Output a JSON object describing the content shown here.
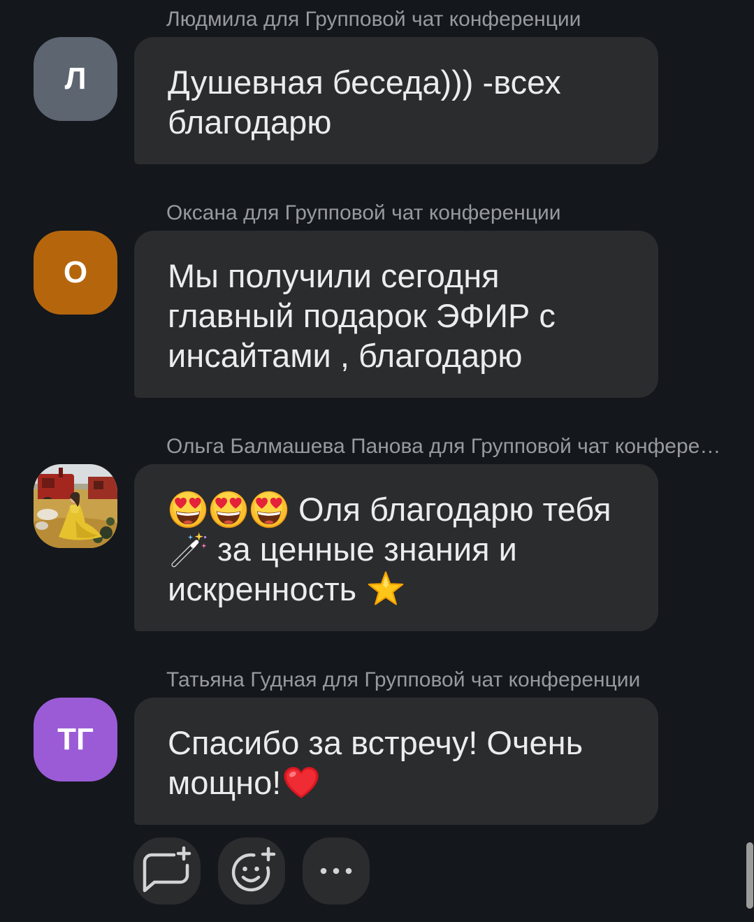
{
  "theme": {
    "background": "#14171c",
    "bubble": "#2b2c2e",
    "text": "#ececec",
    "meta": "#979a9f",
    "icon": "#d3d4d6",
    "scrollbar": "#9c9c9c"
  },
  "feed": {
    "messages": [
      {
        "sender_line": "Людмила для Групповой чат конференции",
        "avatar": {
          "initials": "Л",
          "color": "#5d6570"
        },
        "lines": [
          [
            {
              "text": "Душевная беседа))) -всех"
            }
          ],
          [
            {
              "text": "благодарю"
            }
          ]
        ]
      },
      {
        "sender_line": "Оксана для Групповой чат конференции",
        "avatar": {
          "initials": "О",
          "color": "#b5660c"
        },
        "lines": [
          [
            {
              "text": "Мы получили сегодня"
            }
          ],
          [
            {
              "text": "главный подарок ЭФИР с"
            }
          ],
          [
            {
              "text": "инсайтами , благодарю"
            }
          ]
        ]
      },
      {
        "sender_line": "Ольга Балмашева Панова для Групповой чат конфере…",
        "avatar": {
          "icon": "profile-photo"
        },
        "lines": [
          [
            {
              "emoji": "smiling-face-with-heart-eyes"
            },
            {
              "emoji": "smiling-face-with-heart-eyes"
            },
            {
              "emoji": "smiling-face-with-heart-eyes"
            },
            {
              "text": " Оля благодарю тебя"
            }
          ],
          [
            {
              "emoji": "magic-wand"
            },
            {
              "text": " за ценные знания и"
            }
          ],
          [
            {
              "text": "искренность "
            },
            {
              "emoji": "star"
            }
          ]
        ]
      },
      {
        "sender_line": "Татьяна Гудная для Групповой чат конференции",
        "avatar": {
          "initials": "ТГ",
          "color": "#9b5bd6"
        },
        "lines": [
          [
            {
              "text": "Спасибо за встречу! Очень"
            }
          ],
          [
            {
              "text": "мощно!"
            },
            {
              "emoji": "red-heart"
            }
          ]
        ]
      }
    ]
  },
  "actions": [
    {
      "icon": "comment-add"
    },
    {
      "icon": "emoji-add"
    },
    {
      "icon": "more-horizontal"
    }
  ]
}
